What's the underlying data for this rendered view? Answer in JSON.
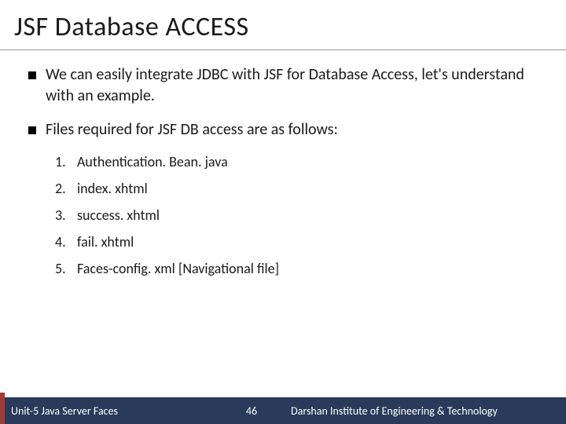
{
  "title": "JSF Database ACCESS",
  "bullets": [
    {
      "text": "We can easily integrate JDBC with JSF for Database Access, let's understand with an example."
    },
    {
      "text": "Files required for JSF DB access are as follows:"
    }
  ],
  "files": [
    {
      "num": "1.",
      "name": "Authentication. Bean. java"
    },
    {
      "num": "2.",
      "name": "index. xhtml"
    },
    {
      "num": "3.",
      "name": "success. xhtml"
    },
    {
      "num": "4.",
      "name": "fail. xhtml"
    },
    {
      "num": "5.",
      "name": "Faces-config. xml [Navigational file]"
    }
  ],
  "footer": {
    "left": "Unit-5 Java Server Faces",
    "page": "46",
    "right": "Darshan Institute of Engineering & Technology"
  }
}
